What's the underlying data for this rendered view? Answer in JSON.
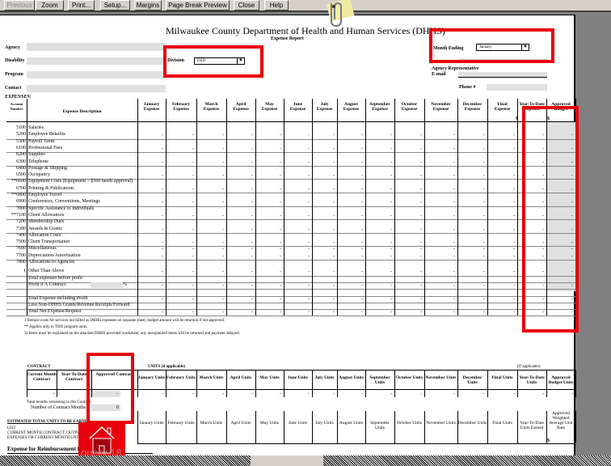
{
  "toolbar": {
    "buttons": [
      {
        "label": "Previous",
        "disabled": true
      },
      {
        "label": "Zoom"
      },
      {
        "label": "Print..."
      },
      {
        "label": "Setup..."
      },
      {
        "label": "Margins"
      },
      {
        "label": "Page Break Preview"
      },
      {
        "label": "Close"
      },
      {
        "label": "Help"
      }
    ]
  },
  "header": {
    "title": "Milwaukee County Department of Health and Human Services (DHHS)",
    "subtitle": "Expense Report",
    "agency_label": "Agency",
    "disability_label": "Disability",
    "program_label": "Program",
    "contact_label": "Contact",
    "division_label": "Division",
    "division_value": "DSD",
    "month_ending_label": "Month Ending",
    "month_ending_value": "January",
    "agency_rep_label": "Agency Representative",
    "email_label": "E-mail",
    "phone_label": "Phone #"
  },
  "expenses": {
    "section_label": "EXPENSES:",
    "account_header": "Account Number",
    "desc_header": "Expense Description",
    "columns": [
      "January Expense",
      "February Expense",
      "March Expense",
      "April Expense",
      "May Expense",
      "June Expense",
      "July Expense",
      "August Expense",
      "September Expense",
      "October Expense",
      "November Expense",
      "December Expense",
      "Final Expense",
      "Year-To-Date Expense",
      "Approved Budget"
    ],
    "dollar_sign": "$",
    "rows": [
      {
        "acct": "5100",
        "desc": "Salaries",
        "dash": false
      },
      {
        "acct": "5200",
        "desc": "Employee Benefits",
        "dash": true
      },
      {
        "acct": "5300",
        "desc": "Payroll Taxes",
        "dash": false
      },
      {
        "acct": "6100",
        "desc": "Professional Fees",
        "dash": true
      },
      {
        "acct": "6200",
        "desc": "Supplies",
        "dash": false
      },
      {
        "acct": "6300",
        "desc": "Telephone",
        "dash": true
      },
      {
        "acct": "6400",
        "desc": "Postage & Shipping",
        "dash": false
      },
      {
        "acct": "6500",
        "desc": "Occupancy",
        "dash": true
      },
      {
        "acct": "**6600",
        "desc": "Equipment Costs (Equipment > $500 needs approval)",
        "dash": false
      },
      {
        "acct": "6700",
        "desc": "Printing & Publications",
        "dash": true
      },
      {
        "acct": "**6800",
        "desc": "Employee Travel",
        "dash": false
      },
      {
        "acct": "6900",
        "desc": "Conferences, Conventions, Meetings",
        "dash": true
      },
      {
        "acct": "7000",
        "desc": "Specific Assistance to Individuals",
        "dash": false
      },
      {
        "acct": "**7100",
        "desc": "Client Allowances",
        "dash": true
      },
      {
        "acct": "7200",
        "desc": "Membership Dues",
        "dash": false
      },
      {
        "acct": "7300",
        "desc": "Awards & Grants",
        "dash": true
      },
      {
        "acct": "7400",
        "desc": "Allocation Costs",
        "dash": false
      },
      {
        "acct": "7500",
        "desc": "Client Transportation",
        "dash": true
      },
      {
        "acct": "7600",
        "desc": "Miscellaneous",
        "dash": true
      },
      {
        "acct": "7700",
        "desc": "Depreciation/Amortization",
        "dash": true
      },
      {
        "acct": "7800",
        "desc": "Allocations to Agencies",
        "dash": false
      }
    ],
    "summary": [
      {
        "acct": "1",
        "desc": "Other Than Above",
        "dash": true
      },
      {
        "acct": "",
        "desc": "Total expenses before profit",
        "dash": false
      },
      {
        "acct": "",
        "desc": "Profit if A Contract",
        "dash": true,
        "pct": "%"
      },
      {
        "acct": "",
        "desc": "",
        "dash": false
      },
      {
        "acct": "",
        "desc": "Total Expense including Profit",
        "dash": true
      },
      {
        "acct": "",
        "desc": "Less Non-DHHS Grants/Revenue Receipts/Forward",
        "dash": false
      },
      {
        "acct": "",
        "desc": "Total Net Expense/Request",
        "dash": true
      }
    ],
    "cell_value": "-"
  },
  "footnotes": [
    "1 Itemize costs for services not billed as DHHS expenses on separate sheet; budget amount will be returned if not approved.",
    "** Applies only to TBD program units.",
    "3) Items must be explained on the attached DHHS provided worksheet; any unexplained items will be returned and payment delayed."
  ],
  "contract": {
    "label": "CONTRACT",
    "units_label": "UNITS (if applicable)",
    "if_applicable": "(If applicable)",
    "headers": [
      "Current Month Contract",
      "Year-To-Date Contract",
      "Approved Contract"
    ],
    "unit_headers": [
      "January Units",
      "February Units",
      "March Units",
      "April Units",
      "May Units",
      "June Units",
      "July Units",
      "August Units",
      "September Units",
      "October Units",
      "November Units",
      "December Units",
      "Final Units",
      "Year-To-Date Units",
      "Approved Budget Units"
    ],
    "remaining_label": "Total months remaining in this Contract",
    "months_label": "Number of Contract Months",
    "months_value": "0"
  },
  "units2": {
    "left_title": "ESTIMATED TOTAL UNITS TO BE EARNED",
    "left_lines": [
      "LIST",
      "CURRENT MONTH CONTRACT, OUTPUT",
      "EXPENSES OR CURRENT MONTH UNITS"
    ],
    "headers": [
      "January Units",
      "February Units",
      "March Units",
      "April Units",
      "May Units",
      "June Units",
      "July Units",
      "August Units",
      "September Units",
      "October Units",
      "November Units",
      "December Units",
      "Final Units",
      "Year-To-Date Units Earned",
      "Approved Weighted Average Unit Rate"
    ],
    "dollar_sign": "$"
  },
  "reimbursement_label": "Expense for Reimbursement for this Request:",
  "overlay_text": "query 18",
  "colors": {
    "highlight": "#e8000b",
    "input_gray": "#e0e0e0"
  }
}
